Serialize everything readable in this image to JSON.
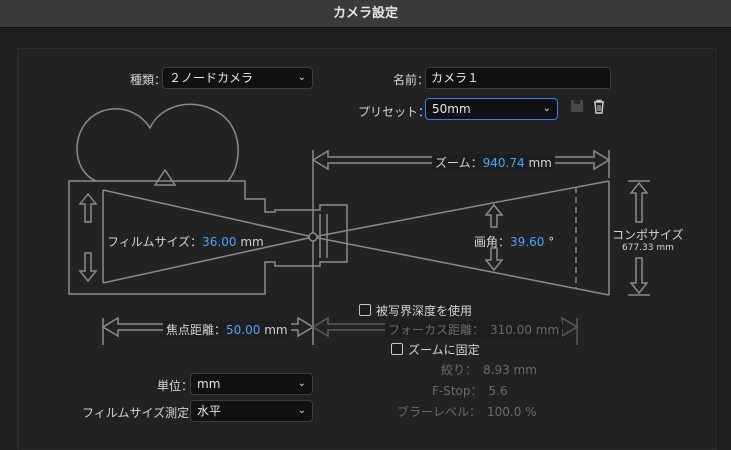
{
  "window": {
    "title": "カメラ設定"
  },
  "form": {
    "type_label": "種類：",
    "type_value": "２ノードカメラ",
    "name_label": "名前：",
    "name_value": "カメラ１",
    "preset_label": "プリセット：",
    "preset_value": "50mm",
    "unit_label": "単位：",
    "unit_value": "mm",
    "film_measure_label": "フィルムサイズ測定：",
    "film_measure_value": "水平"
  },
  "diagram": {
    "zoom_label": "ズーム：",
    "zoom_value": "940.74",
    "zoom_unit": "mm",
    "film_label": "フィルムサイズ：",
    "film_value": "36.00",
    "film_unit": "mm",
    "angle_label": "画角：",
    "angle_value": "39.60",
    "angle_unit": "°",
    "comp_label": "コンポサイズ",
    "comp_value": "677.33 mm",
    "focal_label": "焦点距離：",
    "focal_value": "50.00",
    "focal_unit": "mm"
  },
  "dof": {
    "enable_label": "被写界深度を使用",
    "enable_checked": false,
    "focus_dist": "フォーカス距離：　310.00 mm",
    "lock_label": "ズームに固定",
    "lock_checked": false,
    "aperture": "絞り：　8.93 mm",
    "fstop": "F-Stop：　5.6",
    "blur": "ブラーレベル：　100.0 %"
  },
  "icons": [
    "chevron-down-icon",
    "save-preset-icon",
    "trash-icon"
  ],
  "colors": {
    "accent": "#4aa3ff",
    "focus_border": "#2f80ff",
    "line": "#8a8a8a"
  }
}
